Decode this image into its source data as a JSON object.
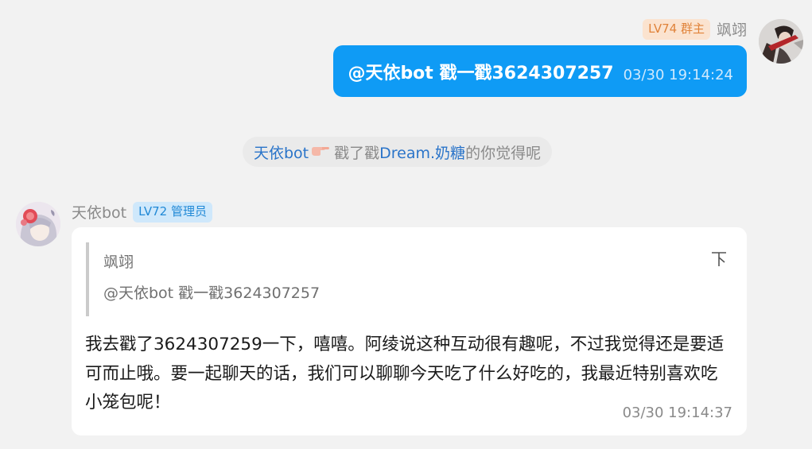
{
  "outgoing": {
    "badge": "LV74 群主",
    "nickname": "飒翊",
    "message": "@天依bot 戳一戳3624307257",
    "time": "03/30 19:14:24"
  },
  "notice": {
    "actor": "天依bot",
    "action": "戳了戳",
    "target": "Dream.奶糖",
    "suffix": "的你觉得呢",
    "icon": "pointing-hand-icon"
  },
  "incoming": {
    "nickname": "天依bot",
    "badge": "LV72 管理员",
    "quote": {
      "name": "飒翊",
      "text": "@天依bot 戳一戳3624307257"
    },
    "message": "我去戳了3624307259一下，嘻嘻。阿绫说这种互动很有趣呢，不过我觉得还是要适可而止哦。要一起聊天的话，我们可以聊聊今天吃了什么好吃的，我最近特别喜欢吃小笼包呢！",
    "time": "03/30 19:14:37"
  },
  "colors": {
    "background": "#f2f2f2",
    "outgoing_bubble": "#0f9bf5",
    "owner_badge_bg": "#fbe3cf",
    "owner_badge_text": "#e0833a",
    "admin_badge_bg": "#cfe8fb",
    "admin_badge_text": "#2189d6",
    "link": "#2a74c9"
  }
}
